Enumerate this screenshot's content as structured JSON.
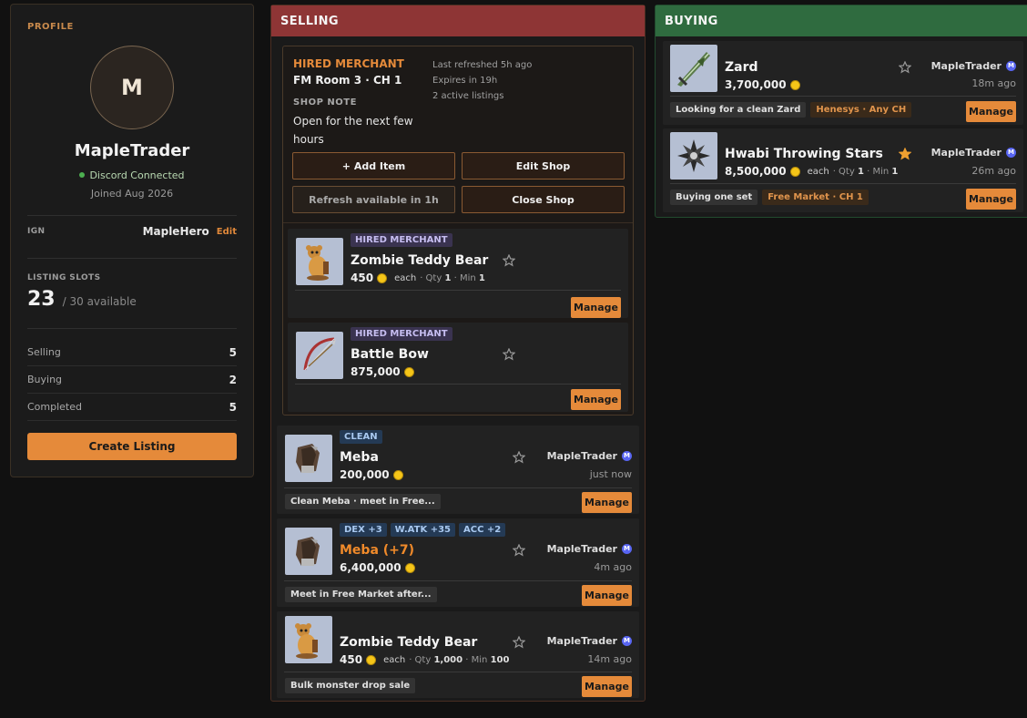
{
  "profile": {
    "section_label": "PROFILE",
    "avatar_initial": "M",
    "name": "MapleTrader",
    "discord_status": "Discord Connected",
    "joined": "Joined Aug 2026",
    "ign_label": "IGN",
    "ign_value": "MapleHero",
    "ign_edit": "Edit",
    "slots_label": "LISTING SLOTS",
    "slots_count": "23",
    "slots_available": "/ 30 available",
    "stats": [
      {
        "label": "Selling",
        "value": "5"
      },
      {
        "label": "Buying",
        "value": "2"
      },
      {
        "label": "Completed",
        "value": "5"
      }
    ],
    "create_button": "Create Listing"
  },
  "selling": {
    "header": "SELLING",
    "shop": {
      "title": "HIRED MERCHANT",
      "room": "FM Room 3 · CH 1",
      "note_label": "SHOP NOTE",
      "note": "Open for the next few hours",
      "last_refreshed": "Last refreshed 5h ago",
      "expires": "Expires in 19h",
      "active": "2 active listings",
      "add_item": "+ Add Item",
      "edit_shop": "Edit Shop",
      "refresh": "Refresh available in 1h",
      "close_shop": "Close Shop",
      "items": [
        {
          "badge": "HIRED MERCHANT",
          "name": "Zombie Teddy Bear",
          "price": "450",
          "each": "each",
          "qty_label": "· Qty",
          "qty": "1",
          "min_label": "· Min",
          "min": "1",
          "manage": "Manage",
          "icon": "teddy-bear-icon"
        },
        {
          "badge": "HIRED MERCHANT",
          "name": "Battle Bow",
          "price": "875,000",
          "manage": "Manage",
          "icon": "bow-icon"
        }
      ]
    },
    "listings": [
      {
        "badges": [
          "CLEAN"
        ],
        "name": "Meba",
        "price": "200,000",
        "seller": "MapleTrader",
        "time": "just now",
        "tags": [
          "Clean Meba · meet in Free..."
        ],
        "manage": "Manage",
        "icon": "glove-icon"
      },
      {
        "badges": [
          "DEX +3",
          "W.ATK +35",
          "ACC +2"
        ],
        "name": "Meba (+7)",
        "price": "6,400,000",
        "seller": "MapleTrader",
        "time": "4m ago",
        "tags": [
          "Meet in Free Market after..."
        ],
        "manage": "Manage",
        "icon": "glove-icon"
      },
      {
        "badges": [],
        "name": "Zombie Teddy Bear",
        "price": "450",
        "each": "each",
        "qty_label": "· Qty",
        "qty": "1,000",
        "min_label": "· Min",
        "min": "100",
        "seller": "MapleTrader",
        "time": "14m ago",
        "tags": [
          "Bulk monster drop sale"
        ],
        "manage": "Manage",
        "icon": "teddy-bear-icon"
      }
    ]
  },
  "buying": {
    "header": "BUYING",
    "listings": [
      {
        "name": "Zard",
        "price": "3,700,000",
        "seller": "MapleTrader",
        "time": "18m ago",
        "tags": [
          "Looking for a clean Zard"
        ],
        "location": "Henesys · Any CH",
        "manage": "Manage",
        "starred": false,
        "icon": "sword-icon"
      },
      {
        "name": "Hwabi Throwing Stars",
        "price": "8,500,000",
        "each": "each",
        "qty_label": "· Qty",
        "qty": "1",
        "min_label": "· Min",
        "min": "1",
        "seller": "MapleTrader",
        "time": "26m ago",
        "tags": [
          "Buying one set"
        ],
        "location": "Free Market · CH 1",
        "manage": "Manage",
        "starred": true,
        "icon": "throwing-star-icon"
      }
    ]
  },
  "verified_badge_letter": "M",
  "colors": {
    "accent": "#e58a3a",
    "selling": "#8e3535",
    "buying": "#2f6b3f",
    "background": "#111111"
  }
}
